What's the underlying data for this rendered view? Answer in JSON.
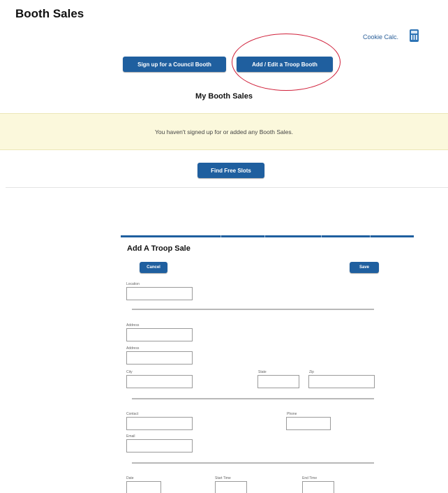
{
  "header": {
    "title": "Booth Sales",
    "calc_link": "Cookie Calc.",
    "calc_icon": "calculator-icon"
  },
  "actions": {
    "council_button": "Sign up for a Council Booth",
    "troop_button": "Add / Edit a Troop Booth"
  },
  "my_sales": {
    "title": "My Booth Sales",
    "empty_message": "You haven't signed up for or added any Booth Sales.",
    "find_button": "Find Free Slots"
  },
  "form": {
    "title": "Add A Troop Sale",
    "cancel_button": "Cancel",
    "save_button": "Save",
    "labels": {
      "location": "Location",
      "address1": "Address",
      "address2": "Address",
      "city": "City",
      "state": "State",
      "zip": "Zip",
      "contact": "Contact",
      "phone": "Phone",
      "email": "Email",
      "date": "Date",
      "start_time": "Start Time",
      "end_time": "End Time"
    }
  },
  "colors": {
    "accent": "#1f5f9f",
    "highlight_circle": "#d0203a",
    "banner_bg": "#fbf8dc"
  }
}
